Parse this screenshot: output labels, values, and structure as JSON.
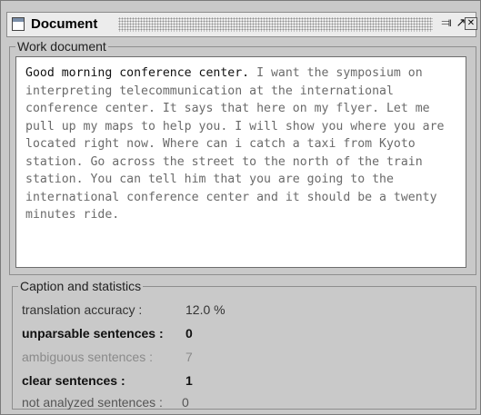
{
  "window": {
    "title": "Document",
    "buttons": {
      "iconify": "⫥",
      "maximize": "↗",
      "close": "✕"
    }
  },
  "document": {
    "group_label": "Work document",
    "highlighted_text": "Good morning conference center.",
    "body_text": " I want the symposium on interpreting telecommunication at the international conference center. It says that here on my flyer. Let me pull up my maps to help you. I will show you where you are located right now. Where can i catch a taxi from Kyoto station. Go across the street to the north of the train station. You can tell him that you are going to the international conference center and it should be a twenty minutes ride."
  },
  "stats": {
    "group_label": "Caption and statistics",
    "rows": [
      {
        "label": "translation accuracy :",
        "value": "12.0 %",
        "color": "#333333",
        "bold": false
      },
      {
        "label": "unparsable sentences :",
        "value": "0",
        "color": "#111111",
        "bold": true
      },
      {
        "label": "ambiguous sentences :",
        "value": "7",
        "color": "#8a8a8a",
        "bold": false
      },
      {
        "label": "clear sentences :",
        "value": "1",
        "color": "#111111",
        "bold": true
      },
      {
        "label": "not analyzed sentences :",
        "value": "0",
        "color": "#555555",
        "bold": false
      }
    ]
  }
}
